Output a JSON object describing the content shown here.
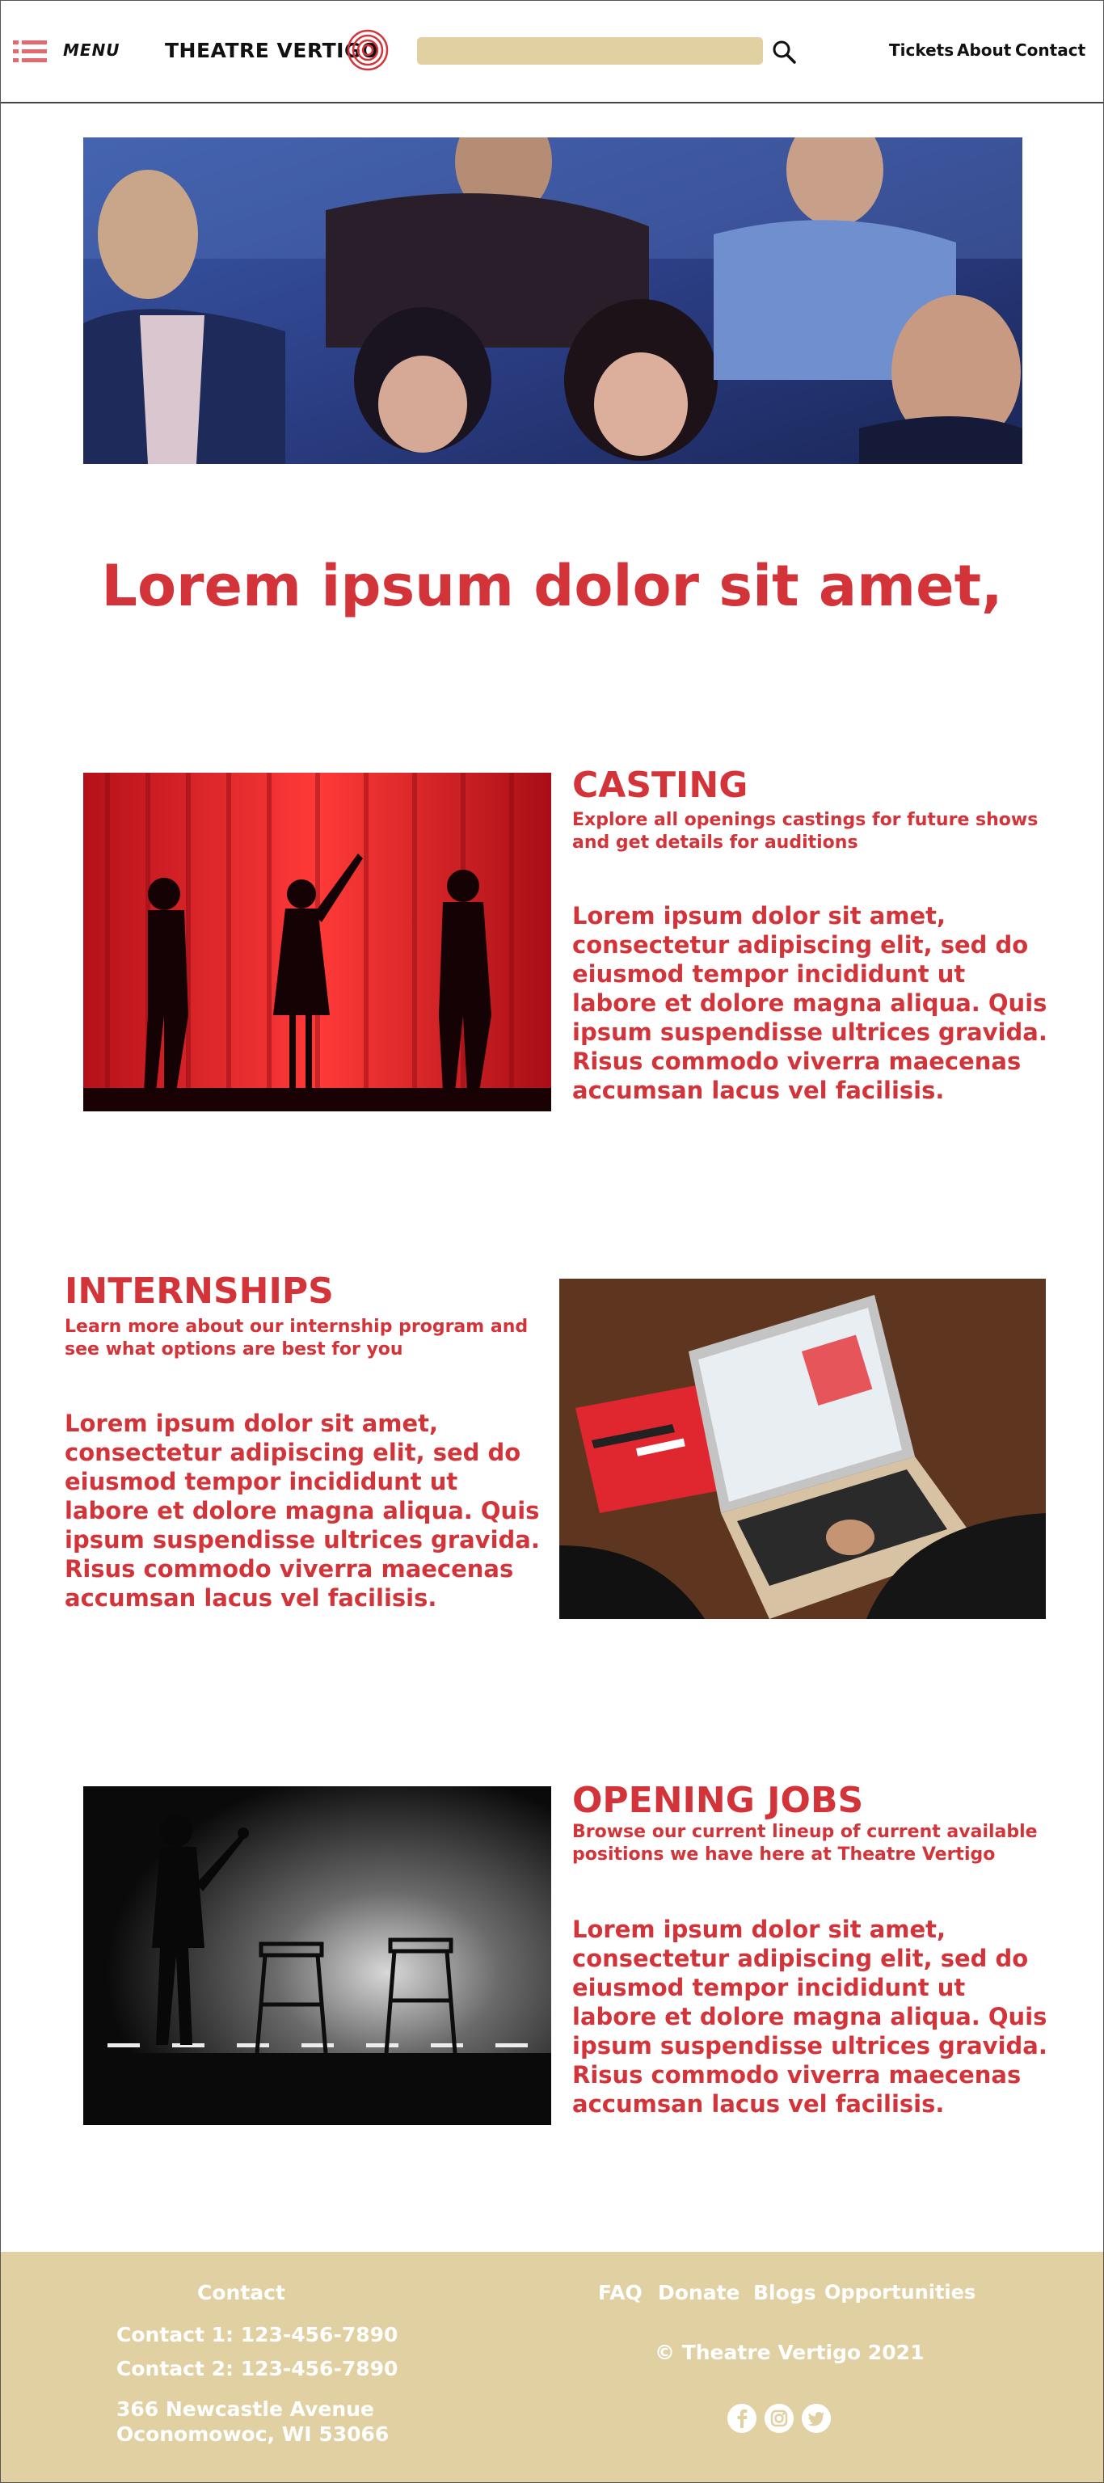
{
  "header": {
    "menu_label": "MENU",
    "logo_text": "THEATRE VERTIGO",
    "search": {
      "placeholder": "",
      "value": ""
    },
    "nav": [
      "Tickets",
      "About",
      "Contact"
    ]
  },
  "main": {
    "headline": "Lorem ipsum dolor sit amet,",
    "sections": [
      {
        "title": "CASTING",
        "subtitle": "Explore all openings castings for future shows and get details for auditions",
        "body": "Lorem ipsum dolor sit amet, consectetur adipiscing elit, sed do eiusmod tempor incididunt ut labore et dolore magna aliqua. Quis ipsum suspendisse ultrices gravida. Risus commodo viverra maecenas accumsan lacus vel facilisis."
      },
      {
        "title": "INTERNSHIPS",
        "subtitle": "Learn more about our internship program and see what options are best for you",
        "body": "Lorem ipsum dolor sit amet, consectetur adipiscing elit, sed do eiusmod tempor incididunt ut labore et dolore magna aliqua. Quis ipsum suspendisse ultrices gravida. Risus commodo viverra maecenas accumsan lacus vel facilisis."
      },
      {
        "title": "OPENING JOBS",
        "subtitle": "Browse our current lineup of current available positions we have here at Theatre Vertigo",
        "body": "Lorem ipsum dolor sit amet, consectetur adipiscing elit, sed do eiusmod tempor incididunt ut labore et dolore magna aliqua. Quis ipsum suspendisse ultrices gravida. Risus commodo viverra maecenas accumsan lacus vel facilisis."
      }
    ]
  },
  "footer": {
    "contact_heading": "Contact",
    "contact_1": "Contact 1: 123-456-7890",
    "contact_2": "Contact 2: 123-456-7890",
    "address_line1": "366 Newcastle Avenue",
    "address_line2": "Oconomowoc, WI 53066",
    "links": [
      "FAQ",
      "Donate",
      "Blogs",
      "Opportunities"
    ],
    "copyright": "© Theatre Vertigo 2021",
    "social_icons": [
      "facebook-icon",
      "instagram-icon",
      "twitter-icon"
    ]
  },
  "colors": {
    "accent": "#d3343a",
    "footer_bg": "#e0d0a2",
    "search_bg": "#e0d0a2",
    "menu_icon": "#e06a6e"
  }
}
